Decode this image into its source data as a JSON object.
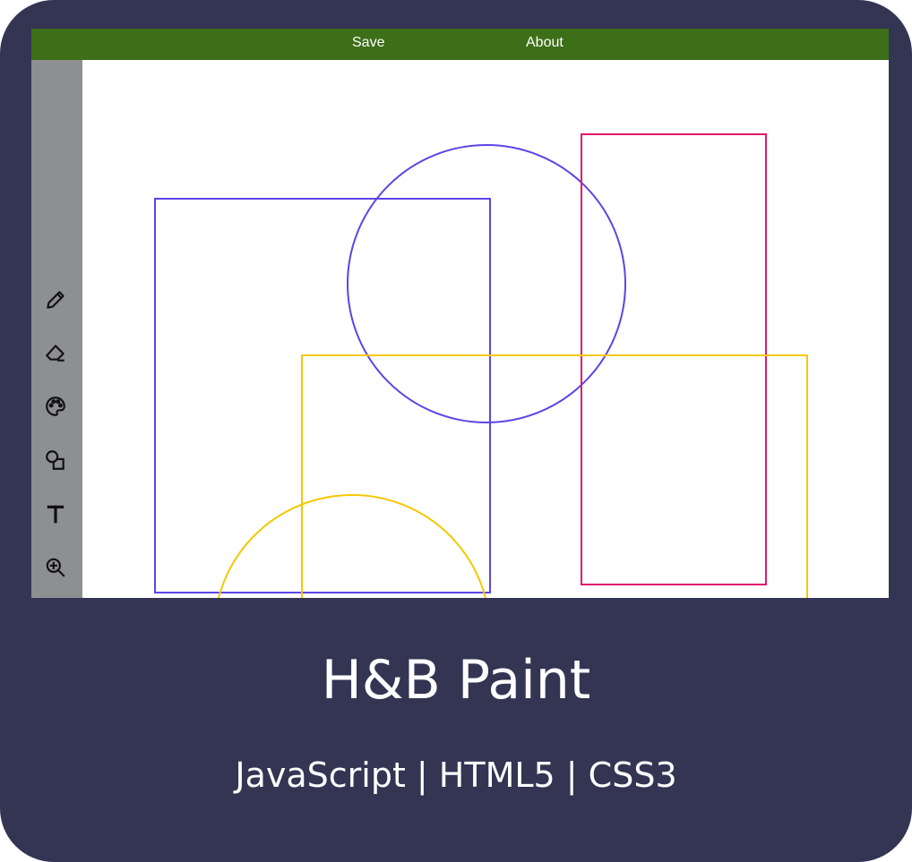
{
  "app": {
    "title": "H&B Paint",
    "tech_stack": "JavaScript | HTML5 | CSS3"
  },
  "menubar": {
    "items": [
      {
        "label": "Save"
      },
      {
        "label": "About"
      }
    ],
    "color": "#3d6f19"
  },
  "toolbar": {
    "tools": [
      {
        "icon": "pencil-icon"
      },
      {
        "icon": "eraser-icon"
      },
      {
        "icon": "palette-icon"
      },
      {
        "icon": "shapes-icon"
      },
      {
        "icon": "text-icon"
      },
      {
        "icon": "zoom-in-icon"
      },
      {
        "icon": "zoom-out-icon"
      }
    ],
    "color": "#8e8f91"
  },
  "canvas": {
    "shapes": [
      {
        "type": "rectangle",
        "color": "#5b45e6"
      },
      {
        "type": "circle",
        "color": "#5b45e6"
      },
      {
        "type": "rectangle",
        "color": "#e0196b"
      },
      {
        "type": "rectangle",
        "color": "#f5c800"
      },
      {
        "type": "circle",
        "color": "#f5c800"
      }
    ]
  },
  "colors": {
    "card_background": "#333553",
    "text": "#ffffff"
  }
}
